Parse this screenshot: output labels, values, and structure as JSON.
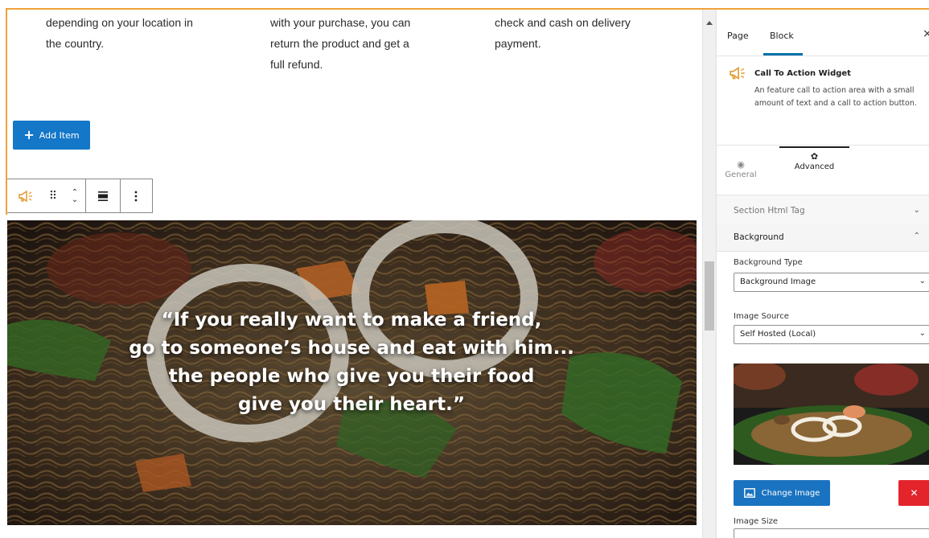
{
  "editor": {
    "columns": [
      {
        "lines": [
          "depending on your location in",
          "the country."
        ]
      },
      {
        "lines": [
          "with your purchase, you can",
          "return the product and get a",
          "full refund."
        ]
      },
      {
        "lines": [
          "check and cash on delivery",
          "payment."
        ]
      }
    ],
    "add_item_label": "Add Item",
    "quote_lines": [
      "“If you really want to make a friend,",
      "go to someone’s house and eat with him...",
      "the people who give you their food",
      "give you their heart.”"
    ]
  },
  "sidebar": {
    "tabs": {
      "page": "Page",
      "block": "Block"
    },
    "close": "×",
    "block": {
      "title": "Call To Action Widget",
      "description": "An feature call to action area with a small amount of text and a call to action button."
    },
    "settings_tabs": {
      "general": "General",
      "advanced": "Advanced"
    },
    "panels": {
      "section_html_tag": "Section Html Tag",
      "background": "Background"
    },
    "background_type": {
      "label": "Background Type",
      "value": "Background Image"
    },
    "image_source": {
      "label": "Image Source",
      "value": "Self Hosted (Local)"
    },
    "change_image_label": "Change Image",
    "remove_label": "✕",
    "image_size": {
      "label": "Image Size"
    }
  },
  "colors": {
    "accent": "#1477c8",
    "danger": "#e3242b",
    "selection": "#f0a13a"
  }
}
